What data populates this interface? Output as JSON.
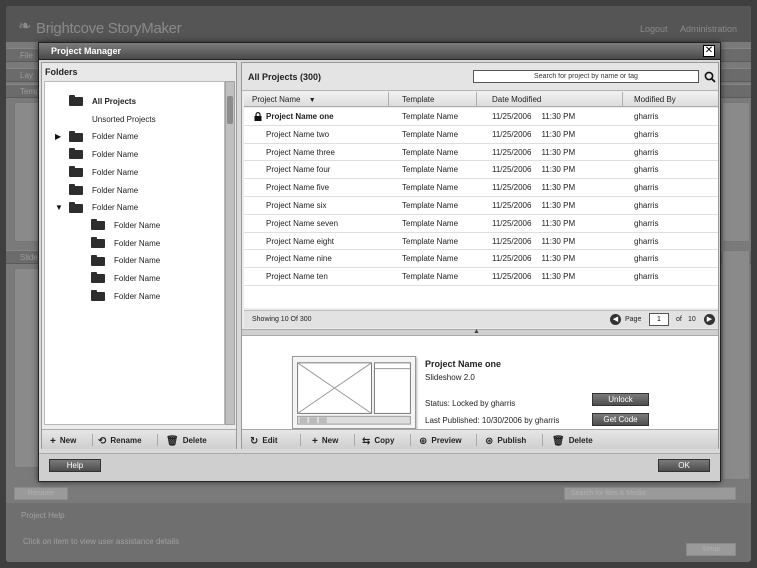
{
  "background_app": {
    "logo": "Brightcove StoryMaker",
    "top_links": [
      "Logout",
      "Administration"
    ],
    "bands": [
      "File",
      "Lay",
      "Temp",
      "Slide"
    ],
    "footer_title": "Project Help",
    "footer_text": "Click on item to view user assistance details",
    "right_search_placeholder": "Search for files & Media",
    "bottom_button": "Rename",
    "footer_button": "Setup"
  },
  "modal": {
    "title": "Project Manager",
    "close_label": "✕",
    "help_label": "Help",
    "ok_label": "OK"
  },
  "folders": {
    "title": "Folders",
    "items": [
      {
        "label": "All Projects",
        "bold": true,
        "level": 0,
        "arrow": ""
      },
      {
        "label": "Unsorted Projects",
        "bold": false,
        "level": 0,
        "arrow": "",
        "no_icon": true
      },
      {
        "label": "Folder Name",
        "bold": false,
        "level": 0,
        "arrow": "▶"
      },
      {
        "label": "Folder Name",
        "bold": false,
        "level": 0,
        "arrow": ""
      },
      {
        "label": "Folder Name",
        "bold": false,
        "level": 0,
        "arrow": ""
      },
      {
        "label": "Folder Name",
        "bold": false,
        "level": 0,
        "arrow": ""
      },
      {
        "label": "Folder Name",
        "bold": false,
        "level": 0,
        "arrow": "▼"
      },
      {
        "label": "Folder Name",
        "bold": false,
        "level": 1,
        "arrow": ""
      },
      {
        "label": "Folder Name",
        "bold": false,
        "level": 1,
        "arrow": ""
      },
      {
        "label": "Folder Name",
        "bold": false,
        "level": 1,
        "arrow": ""
      },
      {
        "label": "Folder Name",
        "bold": false,
        "level": 1,
        "arrow": ""
      },
      {
        "label": "Folder Name",
        "bold": false,
        "level": 1,
        "arrow": ""
      }
    ],
    "toolbar": {
      "new": "New",
      "rename": "Rename",
      "delete": "Delete"
    }
  },
  "projects": {
    "title": "All Projects (300)",
    "search_placeholder": "Search for project by name or tag",
    "columns": [
      "Project Name",
      "Template",
      "Date Modified",
      "Modified By"
    ],
    "sort_indicator": "▼",
    "rows": [
      {
        "name": "Project Name one",
        "template": "Template Name",
        "date": "11/25/2006",
        "time": "11:30 PM",
        "by": "gharris",
        "locked": true
      },
      {
        "name": "Project Name two",
        "template": "Template Name",
        "date": "11/25/2006",
        "time": "11:30 PM",
        "by": "gharris"
      },
      {
        "name": "Project Name three",
        "template": "Template Name",
        "date": "11/25/2006",
        "time": "11:30 PM",
        "by": "gharris"
      },
      {
        "name": "Project Name four",
        "template": "Template Name",
        "date": "11/25/2006",
        "time": "11:30 PM",
        "by": "gharris"
      },
      {
        "name": "Project Name five",
        "template": "Template Name",
        "date": "11/25/2006",
        "time": "11:30 PM",
        "by": "gharris"
      },
      {
        "name": "Project Name six",
        "template": "Template Name",
        "date": "11/25/2006",
        "time": "11:30 PM",
        "by": "gharris"
      },
      {
        "name": "Project Name seven",
        "template": "Template Name",
        "date": "11/25/2006",
        "time": "11:30 PM",
        "by": "gharris"
      },
      {
        "name": "Project Name eight",
        "template": "Template Name",
        "date": "11/25/2006",
        "time": "11:30 PM",
        "by": "gharris"
      },
      {
        "name": "Project Name nine",
        "template": "Template Name",
        "date": "11/25/2006",
        "time": "11:30 PM",
        "by": "gharris"
      },
      {
        "name": "Project Name ten",
        "template": "Template Name",
        "date": "11/25/2006",
        "time": "11:30 PM",
        "by": "gharris"
      }
    ],
    "showing": "Showing 10 Of 300",
    "pager": {
      "page_label": "Page",
      "current": "1",
      "of_label": "of",
      "total": "10"
    },
    "detail": {
      "name": "Project Name one",
      "type": "Slideshow 2.0",
      "status": "Status: Locked by gharris",
      "published": "Last Published: 10/30/2006 by gharris",
      "unlock": "Unlock",
      "get_code": "Get Code"
    },
    "toolbar": {
      "edit": "Edit",
      "new": "New",
      "copy": "Copy",
      "preview": "Preview",
      "publish": "Publish",
      "delete": "Delete"
    }
  }
}
